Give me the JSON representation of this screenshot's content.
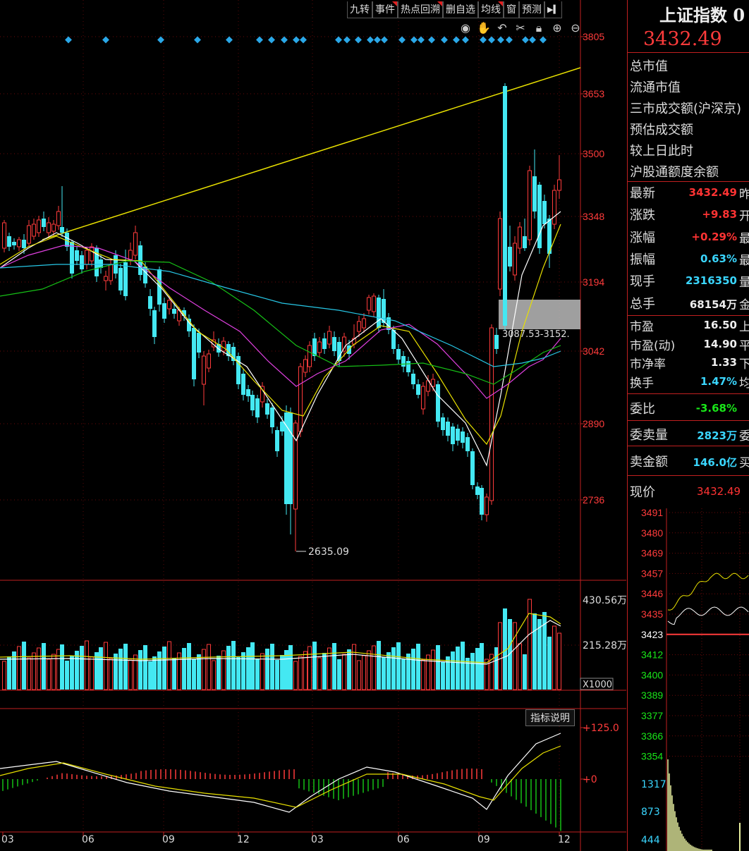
{
  "toolbar": [
    "九转",
    "事件",
    "热点回溯",
    "删自选",
    "均线",
    "窗",
    "预测"
  ],
  "toolbar_marked": [
    false,
    true,
    true,
    false,
    true,
    false,
    false
  ],
  "toolbar_end_icon": "expand-right-icon",
  "chart_tools": [
    "eye-icon",
    "hand-icon",
    "undo-icon",
    "scissors-icon",
    "lock-icon",
    "zoom-in-icon",
    "zoom-out-icon"
  ],
  "chart_data": {
    "type": "candlestick",
    "price_axis": [
      "3805",
      "3653",
      "3500",
      "3348",
      "3194",
      "3042",
      "2890",
      "2736"
    ],
    "x_ticks": [
      "03",
      "06",
      "09",
      "12",
      "03",
      "06",
      "09",
      "12"
    ],
    "low_annotation": "2635.09",
    "box_annotation": "3087.53-3152.",
    "volume_axis": [
      "430.56万",
      "215.28万"
    ],
    "volume_unit": "X1000",
    "macd_axis": [
      "+125.0",
      "+0"
    ],
    "moving_average_colors": {
      "ma5": "#ffffff",
      "ma10": "#e8e000",
      "ma20": "#e040e0",
      "ma60": "#16c016",
      "ma120": "#27c7e6"
    }
  },
  "indicator_button": "指标说明",
  "panel": {
    "title": "上证指数 0",
    "price": "3432.49",
    "labels1": [
      "总市值",
      "流通市值",
      "三市成交额(沪深京)",
      "预估成交额",
      "较上日此时",
      "沪股通额度余额"
    ],
    "quotes": [
      {
        "label": "最新",
        "value": "3432.49",
        "tail": "昨",
        "color": "red"
      },
      {
        "label": "涨跌",
        "value": "+9.83",
        "tail": "开",
        "color": "red"
      },
      {
        "label": "涨幅",
        "value": "+0.29%",
        "tail": "最",
        "color": "red"
      },
      {
        "label": "振幅",
        "value": "0.63%",
        "tail": "最",
        "color": "cyan"
      },
      {
        "label": "现手",
        "value": "2316350",
        "tail": "量",
        "color": "cyan"
      },
      {
        "label": "总手",
        "value": "68154万",
        "tail": "金",
        "color": "white"
      }
    ],
    "valuation": [
      {
        "label": "市盈",
        "value": "16.50",
        "tail": "上",
        "color": "white"
      },
      {
        "label": "市盈(动)",
        "value": "14.90",
        "tail": "平",
        "color": "white"
      },
      {
        "label": "市净率",
        "value": "1.33",
        "tail": "下",
        "color": "white"
      },
      {
        "label": "换手",
        "value": "1.47%",
        "tail": "均",
        "color": "cyan"
      }
    ],
    "weibi": {
      "label": "委比",
      "value": "-3.68%"
    },
    "weimai": {
      "label": "委卖量",
      "value": "2823万",
      "tail": "委"
    },
    "maijin": {
      "label": "卖金额",
      "value": "146.0亿",
      "tail": "买"
    },
    "xianjia": {
      "label": "现价",
      "value": "3432.49"
    },
    "mini_axis": [
      "3491",
      "3480",
      "3469",
      "3457",
      "3446",
      "3435",
      "3423",
      "3412",
      "3400",
      "3389",
      "3377",
      "3366",
      "3354"
    ],
    "mini_vol_axis": [
      "1317",
      "873",
      "444"
    ]
  }
}
